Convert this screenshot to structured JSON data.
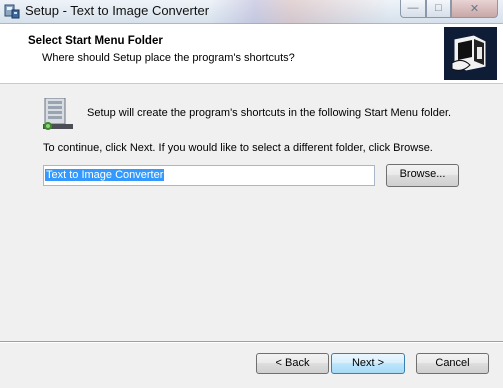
{
  "window": {
    "title": "Setup - Text to Image Converter",
    "minimize_glyph": "—",
    "maximize_glyph": "□",
    "close_glyph": "✕"
  },
  "header": {
    "title": "Select Start Menu Folder",
    "subtitle": "Where should Setup place the program's shortcuts?",
    "logo_icon": "installer-computer-icon"
  },
  "content": {
    "info_icon": "start-menu-folder-icon",
    "line1": "Setup will create the program's shortcuts in the following Start Menu folder.",
    "line2": "To continue, click Next. If you would like to select a different folder, click Browse.",
    "folder_value": "Text to Image Converter",
    "browse_label": "Browse..."
  },
  "footer": {
    "back_label": "< Back",
    "next_label": "Next >",
    "cancel_label": "Cancel"
  },
  "colors": {
    "selection": "#3399ff",
    "logo_bg": "#0e1c36",
    "default_button_border": "#3c7fb1"
  }
}
